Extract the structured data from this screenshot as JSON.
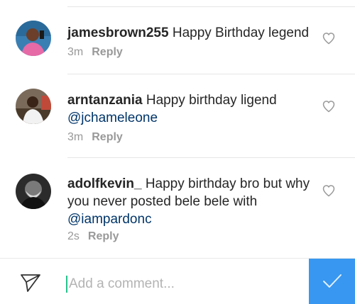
{
  "comments": [
    {
      "username": "jamesbrown255",
      "text_parts": [
        " Happy Birthday legend"
      ],
      "time": "3m",
      "reply_label": "Reply"
    },
    {
      "username": "arntanzania",
      "text_parts": [
        " Happy birthday ligend",
        "@jchameleone"
      ],
      "time": "3m",
      "reply_label": "Reply"
    },
    {
      "username": "adolfkevin_",
      "text_parts": [
        " Happy birthday  bro but why you never posted bele bele with",
        "@iampardonc"
      ],
      "time": "2s",
      "reply_label": "Reply"
    }
  ],
  "composer": {
    "placeholder": "Add a comment...",
    "send_icon": "paper-plane-icon",
    "post_icon": "checkmark-icon"
  },
  "colors": {
    "accent": "#3897f0",
    "mention": "#003569",
    "meta": "#999999",
    "cursor": "#27c28a"
  }
}
